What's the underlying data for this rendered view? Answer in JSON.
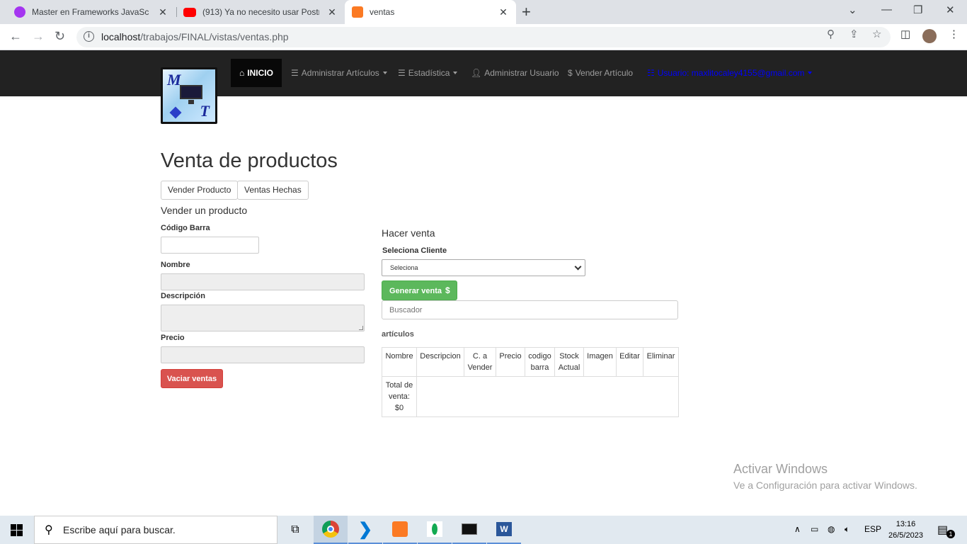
{
  "browser": {
    "tabs": [
      {
        "title": "Master en Frameworks JavaScript",
        "favicon": "udemy-icon",
        "active": false
      },
      {
        "title": "(913) Ya no necesito usar Postman",
        "favicon": "youtube-icon",
        "active": false
      },
      {
        "title": "ventas",
        "favicon": "xampp-icon",
        "active": true
      }
    ],
    "url_host": "localhost",
    "url_path": "/trabajos/FINAL/vistas/ventas.php"
  },
  "navbar": {
    "home": "INICIO",
    "items": [
      "Administrar Artículos",
      "Estadística",
      "Administrar Usuario",
      "Vender Artículo"
    ],
    "user": "Usuario: maxlitocaley4155@gmail.com"
  },
  "page": {
    "title": "Venta de productos",
    "buttons": [
      "Vender Producto",
      "Ventas Hechas"
    ]
  },
  "sell_form": {
    "title": "Vender un producto",
    "barcode_label": "Código Barra",
    "name_label": "Nombre",
    "description_label": "Descripción",
    "price_label": "Precio",
    "clear_button": "Vaciar ventas"
  },
  "sale": {
    "title": "Hacer venta",
    "client_label": "Seleciona Cliente",
    "client_selected": "Seleciona",
    "generate_button": "Generar venta",
    "generate_symbol": "$",
    "search_placeholder": "Buscador",
    "articles_label": "artículos",
    "table_headers": [
      "Nombre",
      "Descripcion",
      "C. a Vender",
      "Precio",
      "codigo barra",
      "Stock Actual",
      "Imagen",
      "Editar",
      "Eliminar"
    ],
    "total_label": "Total de venta:",
    "total_value": "$0"
  },
  "watermark": {
    "line1": "Activar Windows",
    "line2": "Ve a Configuración para activar Windows."
  },
  "taskbar": {
    "search_placeholder": "Escribe aquí para buscar.",
    "language": "ESP",
    "time": "13:16",
    "date": "26/5/2023",
    "notifications": "1"
  },
  "colors": {
    "navbar_bg": "#222222",
    "danger": "#d9534f",
    "success": "#5cb85c",
    "user_link": "#0000ff"
  }
}
